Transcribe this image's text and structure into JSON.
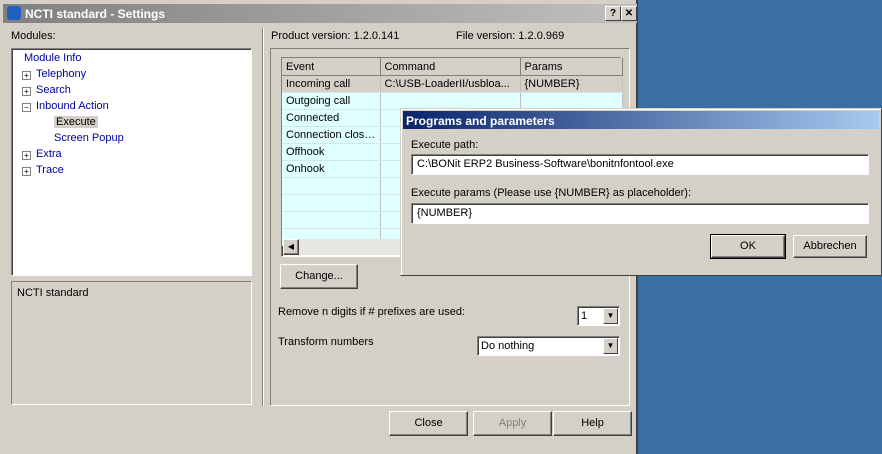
{
  "window": {
    "title": "NCTI standard  - Settings",
    "help_btn": "?",
    "close_btn": "✕"
  },
  "modules": {
    "label": "Modules:",
    "tree": [
      {
        "label": "Module Info",
        "expander": ""
      },
      {
        "label": "Telephony",
        "expander": "+"
      },
      {
        "label": "Search",
        "expander": "+"
      },
      {
        "label": "Inbound Action",
        "expander": "−"
      },
      {
        "label": "Execute",
        "expander": ""
      },
      {
        "label": "Screen Popup",
        "expander": ""
      },
      {
        "label": "Extra",
        "expander": "+"
      },
      {
        "label": "Trace",
        "expander": "+"
      }
    ],
    "description": "NCTI standard"
  },
  "versions": {
    "product": "Product version: 1.2.0.141",
    "file": "File version: 1.2.0.969"
  },
  "events_table": {
    "headers": [
      "Event",
      "Command",
      "Params"
    ],
    "rows": [
      [
        "Incoming call",
        "C:\\USB-LoaderII/usbloa...",
        "{NUMBER}"
      ],
      [
        "Outgoing call",
        "",
        ""
      ],
      [
        "Connected",
        "",
        ""
      ],
      [
        "Connection closed",
        "",
        ""
      ],
      [
        "Offhook",
        "",
        ""
      ],
      [
        "Onhook",
        "",
        ""
      ]
    ]
  },
  "change_button": "Change...",
  "remove_digits": {
    "label": "Remove n digits if # prefixes are used:",
    "value": "1"
  },
  "transform": {
    "label": "Transform numbers",
    "value": "Do nothing"
  },
  "footer": {
    "close": "Close",
    "apply": "Apply",
    "help": "Help"
  },
  "dialog": {
    "title": "Programs and parameters",
    "path_label": "Execute path:",
    "path_value": "C:\\BONit ERP2 Business-Software\\bonitnfontool.exe",
    "params_label": "Execute params (Please use {NUMBER} as placeholder):",
    "params_value": "{NUMBER}",
    "ok": "OK",
    "cancel": "Abbrechen"
  }
}
